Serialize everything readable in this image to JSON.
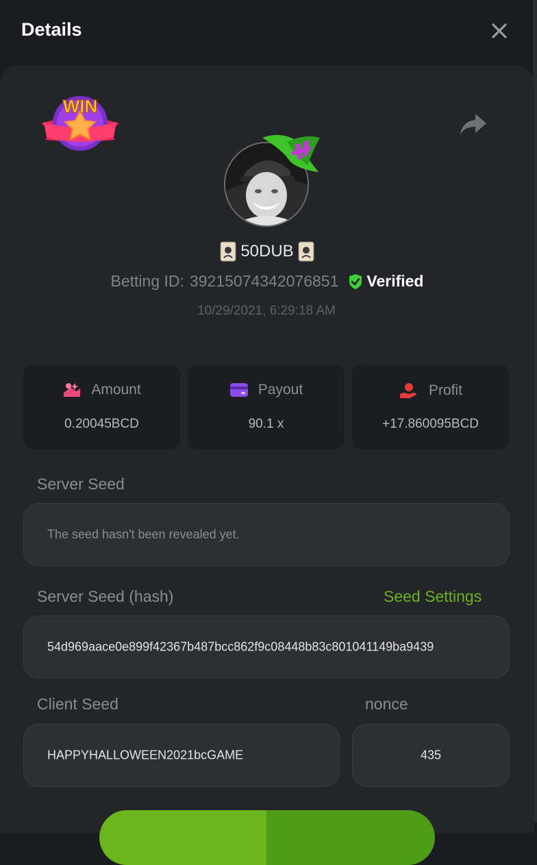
{
  "dialog": {
    "title": "Details"
  },
  "player": {
    "username": "50DUB",
    "betting_id_label": "Betting ID:",
    "betting_id": "39215074342076851",
    "verified_label": "Verified",
    "timestamp": "10/29/2021, 6:29:18 AM"
  },
  "badge": {
    "text": "WIN"
  },
  "stats": [
    {
      "label": "Amount",
      "value": "0.20045BCD",
      "icon": "amount-icon",
      "color": "#e84a7c"
    },
    {
      "label": "Payout",
      "value": "90.1 x",
      "icon": "payout-icon",
      "color": "#8a4be8"
    },
    {
      "label": "Profit",
      "value": "+17.860095BCD",
      "icon": "profit-icon",
      "color": "#e43a3a"
    }
  ],
  "server_seed": {
    "label": "Server Seed",
    "value": "The seed hasn't been revealed yet."
  },
  "server_seed_hash": {
    "label": "Server Seed (hash)",
    "link": "Seed Settings",
    "value": "54d969aace0e899f42367b487bcc862f9c08448b83c801041149ba9439"
  },
  "client_seed": {
    "label": "Client Seed",
    "value": "HAPPYHALLOWEEN2021bcGAME"
  },
  "nonce": {
    "label": "nonce",
    "value": "435"
  },
  "colors": {
    "accent": "#6bb21d",
    "verified": "#3ad13a",
    "panel": "#242529",
    "background": "#1b1c1f"
  }
}
